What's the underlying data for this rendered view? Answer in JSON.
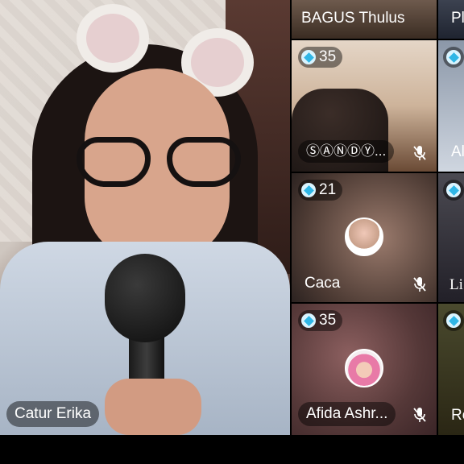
{
  "main_speaker": {
    "name": "Catur Erika"
  },
  "tiles": [
    {
      "id": "bagus",
      "name": "BAGUS Thulus"
    },
    {
      "id": "edge-top",
      "name": "Pl"
    },
    {
      "id": "sandy",
      "name": "ⓈⒶⓃⒹⓎ...",
      "count": "35",
      "muted": true
    },
    {
      "id": "caca",
      "name": "Caca",
      "count": "21",
      "muted": true
    },
    {
      "id": "afida",
      "name": "Afida Ashr...",
      "count": "35",
      "muted": true
    },
    {
      "id": "edge-1",
      "name": "Al"
    },
    {
      "id": "edge-2",
      "name": "Li"
    },
    {
      "id": "edge-3",
      "name": "Re"
    }
  ],
  "colors": {
    "badge_icon": "#2fb6e6",
    "overlay": "rgba(0,0,0,0.45)",
    "text": "#ffffff"
  }
}
